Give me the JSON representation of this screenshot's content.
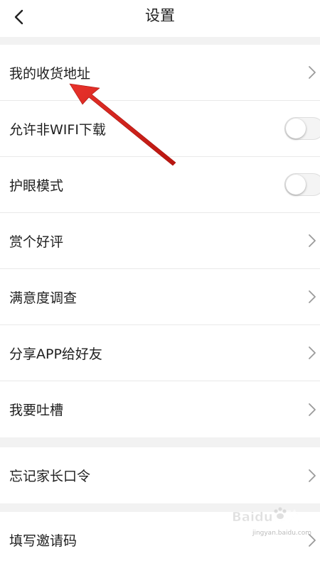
{
  "header": {
    "title": "设置",
    "back_icon": "chevron-left-icon"
  },
  "groups": [
    {
      "items": [
        {
          "label": "我的收货地址",
          "control": "chevron"
        },
        {
          "label": "允许非WIFI下载",
          "control": "toggle",
          "on": false
        },
        {
          "label": "护眼模式",
          "control": "toggle",
          "on": false
        },
        {
          "label": "赏个好评",
          "control": "chevron"
        },
        {
          "label": "满意度调查",
          "control": "chevron"
        },
        {
          "label": "分享APP给好友",
          "control": "chevron"
        },
        {
          "label": "我要吐槽",
          "control": "chevron"
        }
      ]
    },
    {
      "items": [
        {
          "label": "忘记家长口令",
          "control": "chevron"
        }
      ]
    },
    {
      "items": [
        {
          "label": "填写邀请码",
          "control": "chevron"
        }
      ]
    }
  ],
  "watermark": {
    "text": "Baidu经验",
    "url_text": "jingyan.baidu.com"
  },
  "colors": {
    "background": "#f2f2f2",
    "surface": "#ffffff",
    "divider": "#e9e9e9",
    "annotation_arrow": "#d9231d"
  }
}
